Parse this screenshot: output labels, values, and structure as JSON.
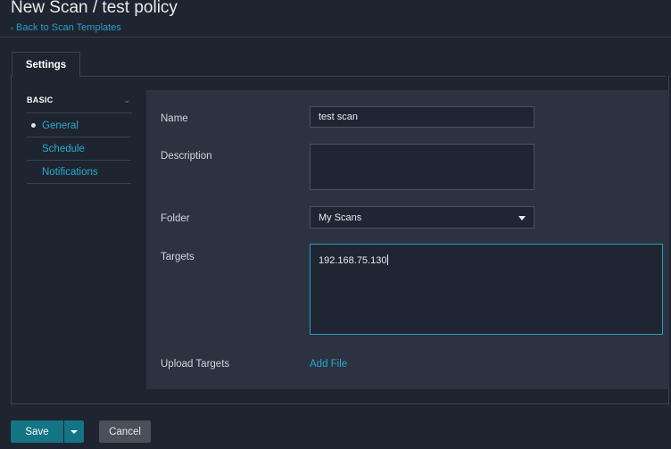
{
  "header": {
    "title": "New Scan / test policy",
    "back_link": "Back to Scan Templates",
    "back_icon": "‹"
  },
  "tabs": [
    {
      "label": "Settings",
      "active": true
    }
  ],
  "sidebar": {
    "section_label": "BASIC",
    "section_icon": "⌄",
    "items": [
      {
        "label": "General",
        "active": true
      },
      {
        "label": "Schedule",
        "active": false
      },
      {
        "label": "Notifications",
        "active": false
      }
    ]
  },
  "form": {
    "name": {
      "label": "Name",
      "value": "test scan"
    },
    "description": {
      "label": "Description",
      "value": ""
    },
    "folder": {
      "label": "Folder",
      "value": "My Scans"
    },
    "targets": {
      "label": "Targets",
      "value": "192.168.75.130"
    },
    "upload_targets": {
      "label": "Upload Targets",
      "link": "Add File"
    }
  },
  "footer": {
    "save_label": "Save",
    "cancel_label": "Cancel"
  },
  "colors": {
    "background": "#1e2430",
    "form_panel": "#2b3240",
    "accent": "#2a9fc4",
    "primary_button": "#137484"
  }
}
